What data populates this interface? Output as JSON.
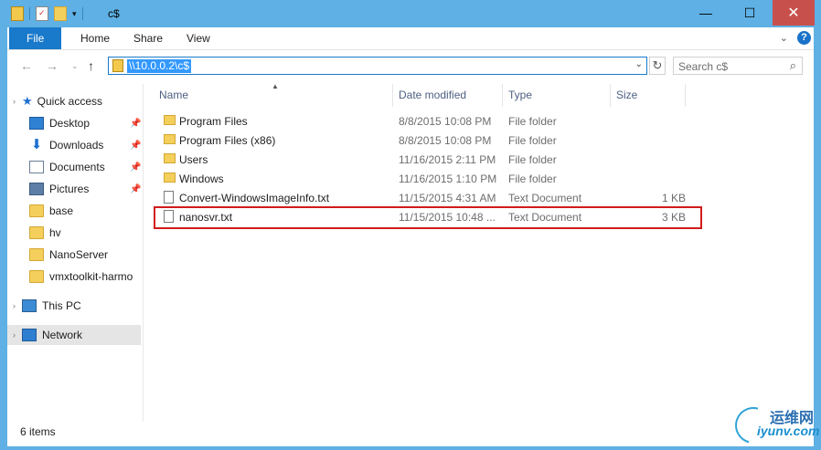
{
  "window": {
    "title": "c$",
    "controls": {
      "minimize": "—",
      "maximize": "☐",
      "close": "✕"
    }
  },
  "ribbon": {
    "tabs": [
      "File",
      "Home",
      "Share",
      "View"
    ],
    "help": "?"
  },
  "address_bar": {
    "path": "\\\\10.0.0.2\\c$",
    "refresh": "↻"
  },
  "search": {
    "placeholder": "Search c$"
  },
  "sidebar": {
    "quick_access": "Quick access",
    "items": [
      {
        "label": "Desktop",
        "icon": "desktop-icon",
        "pinned": true
      },
      {
        "label": "Downloads",
        "icon": "download-icon",
        "pinned": true
      },
      {
        "label": "Documents",
        "icon": "documents-icon",
        "pinned": true
      },
      {
        "label": "Pictures",
        "icon": "pictures-icon",
        "pinned": true
      },
      {
        "label": "base",
        "icon": "folder-icon",
        "pinned": false
      },
      {
        "label": "hv",
        "icon": "folder-icon",
        "pinned": false
      },
      {
        "label": "NanoServer",
        "icon": "folder-icon",
        "pinned": false
      },
      {
        "label": "vmxtoolkit-harmo",
        "icon": "folder-icon",
        "pinned": false
      }
    ],
    "this_pc": "This PC",
    "network": "Network"
  },
  "columns": {
    "name": "Name",
    "date": "Date modified",
    "type": "Type",
    "size": "Size"
  },
  "files": [
    {
      "name": "Program Files",
      "date": "8/8/2015 10:08 PM",
      "type": "File folder",
      "size": "",
      "kind": "folder"
    },
    {
      "name": "Program Files (x86)",
      "date": "8/8/2015 10:08 PM",
      "type": "File folder",
      "size": "",
      "kind": "folder"
    },
    {
      "name": "Users",
      "date": "11/16/2015 2:11 PM",
      "type": "File folder",
      "size": "",
      "kind": "folder"
    },
    {
      "name": "Windows",
      "date": "11/16/2015 1:10 PM",
      "type": "File folder",
      "size": "",
      "kind": "folder"
    },
    {
      "name": "Convert-WindowsImageInfo.txt",
      "date": "11/15/2015 4:31 AM",
      "type": "Text Document",
      "size": "1 KB",
      "kind": "text"
    },
    {
      "name": "nanosvr.txt",
      "date": "11/15/2015 10:48 ...",
      "type": "Text Document",
      "size": "3 KB",
      "kind": "text"
    }
  ],
  "status": {
    "item_count": "6 items"
  },
  "watermark": {
    "cn": "运维网",
    "en": "iyunv.com"
  }
}
